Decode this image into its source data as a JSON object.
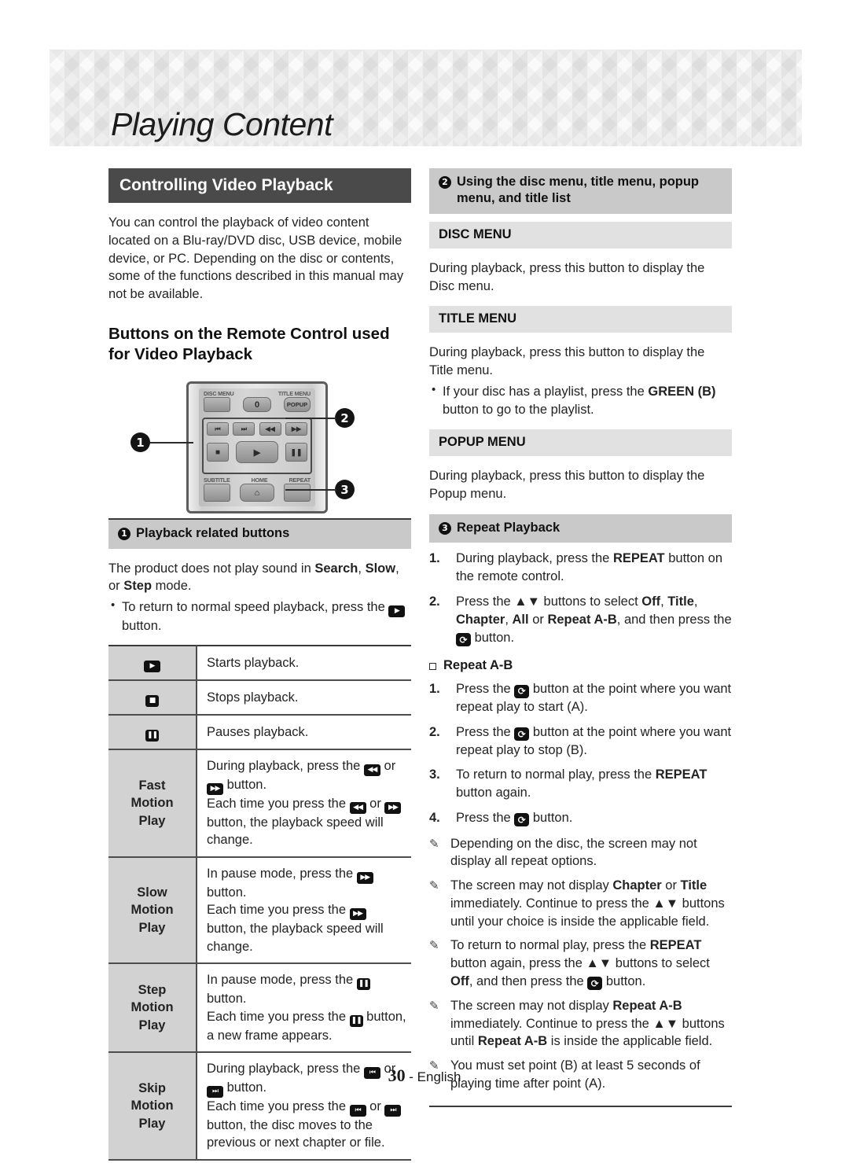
{
  "header": {
    "chapter_title": "Playing Content"
  },
  "left": {
    "banner": "Controlling Video Playback",
    "intro": "You can control the playback of video content located on a Blu-ray/DVD disc, USB device, mobile device, or PC. Depending on the disc or contents, some of the functions described in this manual may not be available.",
    "subhead": "Buttons on the Remote Control used for Video Playback",
    "remote": {
      "labels": {
        "disc_menu": "DISC MENU",
        "title_menu": "TITLE MENU",
        "zero": "0",
        "popup": "POPUP",
        "subtitle": "SUBTITLE",
        "home": "HOME",
        "repeat": "REPEAT"
      },
      "callouts": [
        "1",
        "2",
        "3"
      ]
    },
    "section1": {
      "number": "1",
      "title": "Playback related buttons",
      "body": "The product does not play sound in Search, Slow, or Step mode.",
      "bullet": "To return to normal speed playback, press the ▶ button."
    },
    "table": {
      "rows": [
        {
          "icon": "play-icon",
          "glyph": "▶",
          "label": "",
          "desc": "Starts playback."
        },
        {
          "icon": "stop-icon",
          "glyph": "■",
          "label": "",
          "desc": "Stops playback."
        },
        {
          "icon": "pause-icon",
          "glyph": "❚❚",
          "label": "",
          "desc": "Pauses playback."
        },
        {
          "icon": "",
          "glyph": "",
          "label": "Fast Motion Play",
          "desc": "During playback, press the ◀◀ or ▶▶ button. Each time you press the ◀◀ or ▶▶ button, the playback speed will change."
        },
        {
          "icon": "",
          "glyph": "",
          "label": "Slow Motion Play",
          "desc": "In pause mode, press the ▶▶ button. Each time you press the ▶▶ button, the playback speed will change."
        },
        {
          "icon": "",
          "glyph": "",
          "label": "Step Motion Play",
          "desc": "In pause mode, press the ❚❚ button. Each time you press the ❚❚ button, a new frame appears."
        },
        {
          "icon": "",
          "glyph": "",
          "label": "Skip Motion Play",
          "desc": "During playback, press the |◀◀ or ▶▶| button. Each time you press the |◀◀ or ▶▶| button, the disc moves to the previous or next chapter or file."
        }
      ]
    }
  },
  "right": {
    "section2": {
      "number": "2",
      "title": "Using the disc menu, title menu, popup menu, and title list"
    },
    "disc_menu": {
      "heading": "DISC MENU",
      "body": "During playback, press this button to display the Disc menu."
    },
    "title_menu": {
      "heading": "TITLE MENU",
      "body": "During playback, press this button to display the Title menu.",
      "bullet": "If your disc has a playlist, press the GREEN (B) button to go to the playlist."
    },
    "popup_menu": {
      "heading": "POPUP MENU",
      "body": "During playback, press this button to display the Popup menu."
    },
    "section3": {
      "number": "3",
      "title": "Repeat Playback",
      "steps": [
        {
          "num": "1.",
          "text": "During playback, press the REPEAT button on the remote control."
        },
        {
          "num": "2.",
          "text": "Press the ▲▼ buttons to select Off, Title, Chapter, All or Repeat A-B, and then press the ⏎ button."
        }
      ]
    },
    "repeat_ab": {
      "label": "Repeat A-B",
      "steps": [
        {
          "num": "1.",
          "text": "Press the ⏎ button at the point where you want repeat play to start (A)."
        },
        {
          "num": "2.",
          "text": "Press the ⏎ button at the point where you want repeat play to stop (B)."
        },
        {
          "num": "3.",
          "text": "To return to normal play, press the REPEAT button again."
        },
        {
          "num": "4.",
          "text": "Press the ⏎ button."
        }
      ]
    },
    "notes": [
      "Depending on the disc, the screen may not display all repeat options.",
      "The screen may not display Chapter or Title immediately. Continue to press the ▲▼ buttons until your choice is inside the applicable field.",
      "To return to normal play, press the REPEAT button again, press the ▲▼ buttons to select Off, and then press the ⏎ button.",
      "The screen may not display Repeat A-B immediately. Continue to press the ▲▼ buttons until Repeat A-B is inside the applicable field.",
      "You must set point (B) at least 5 seconds of playing time after point (A)."
    ]
  },
  "footer": {
    "page_number": "30",
    "language": "- English"
  }
}
